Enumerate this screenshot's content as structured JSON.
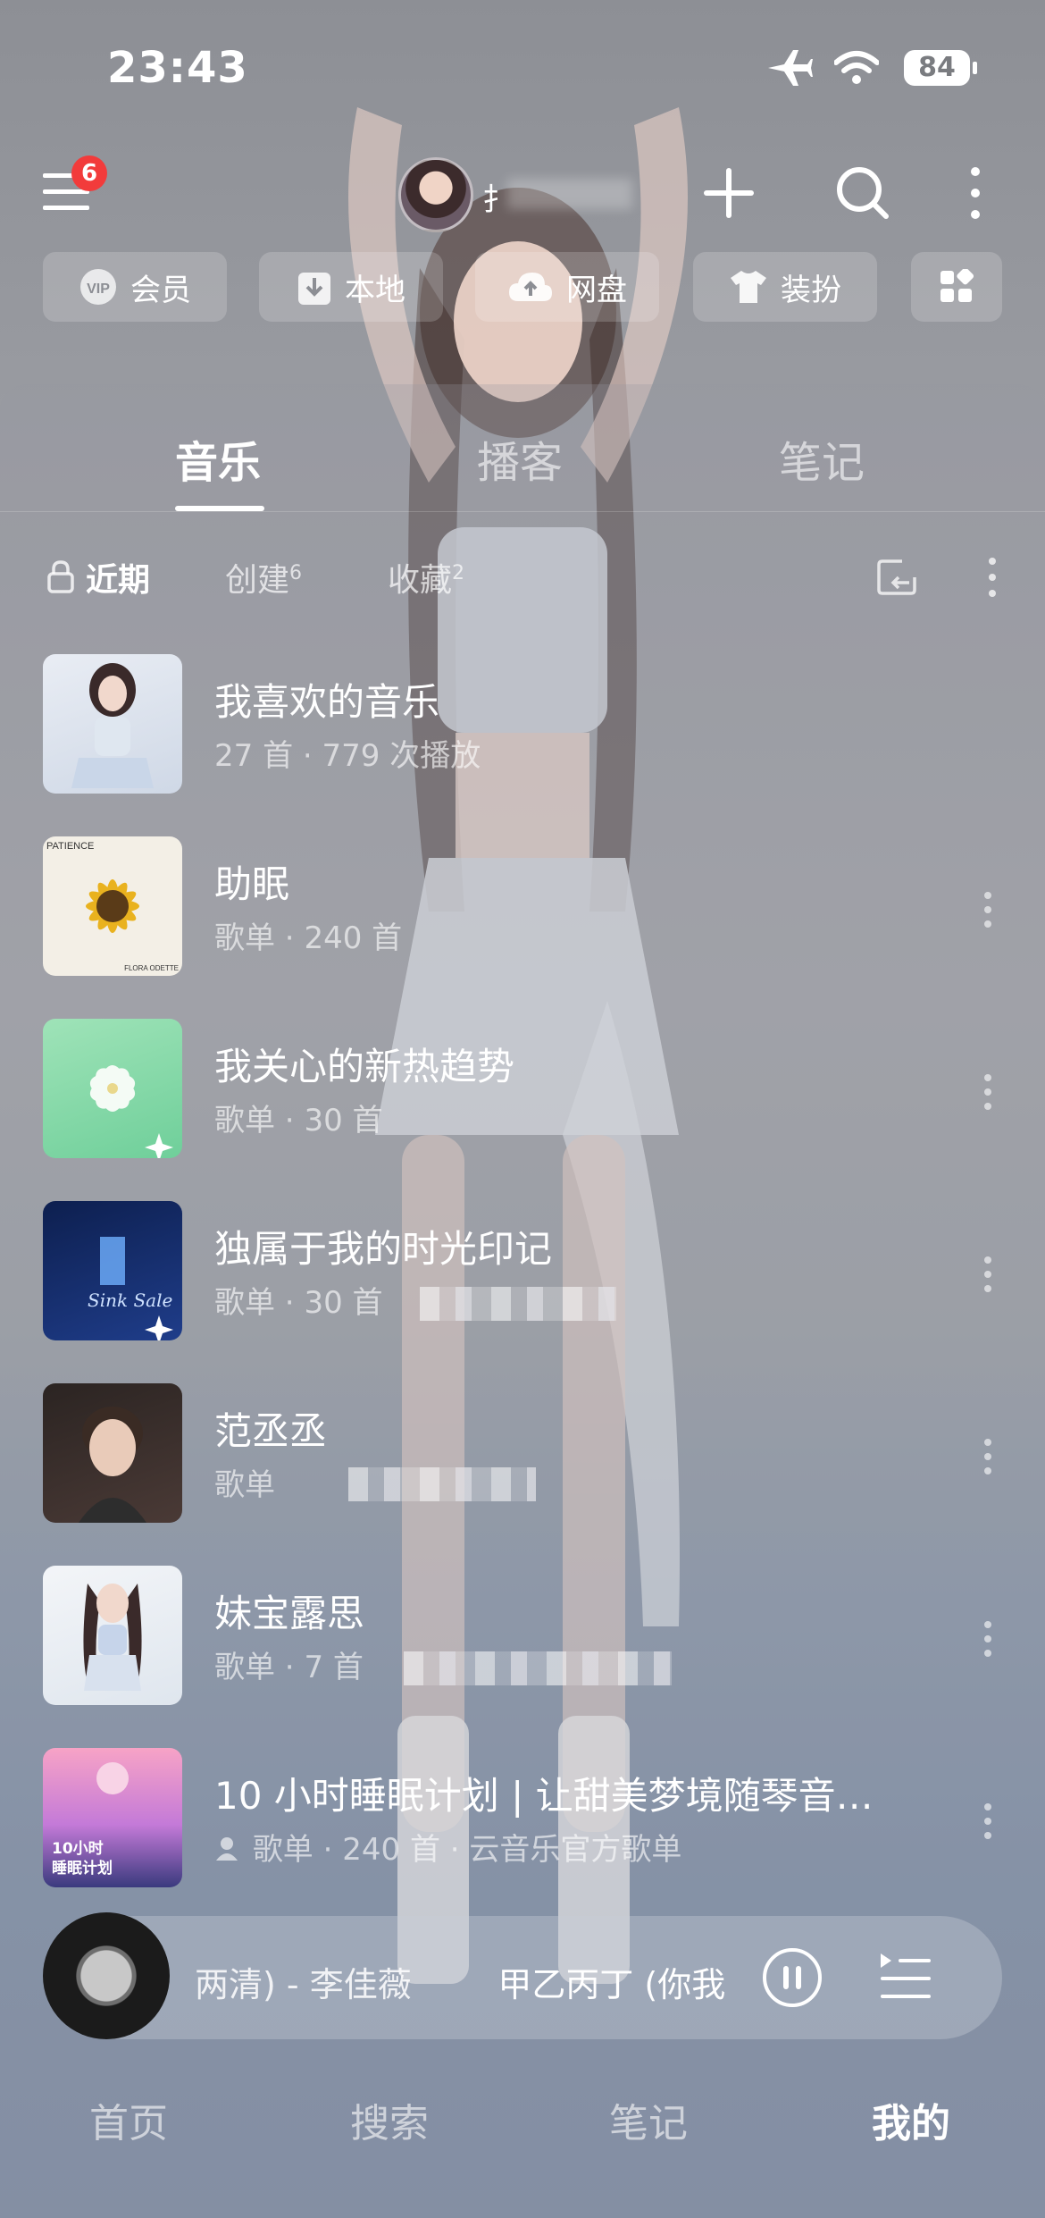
{
  "status": {
    "time": "23:43",
    "battery": "84"
  },
  "topbar": {
    "badge": "6",
    "username": "扌"
  },
  "shortcuts": [
    {
      "label": "会员",
      "icon": "vip-icon"
    },
    {
      "label": "本地",
      "icon": "download-icon"
    },
    {
      "label": "网盘",
      "icon": "cloud-icon"
    },
    {
      "label": "装扮",
      "icon": "shirt-icon"
    }
  ],
  "tabs": [
    {
      "label": "音乐"
    },
    {
      "label": "播客"
    },
    {
      "label": "笔记"
    }
  ],
  "filters": [
    {
      "label": "近期"
    },
    {
      "label": "创建",
      "count": "6"
    },
    {
      "label": "收藏",
      "count": "2"
    }
  ],
  "playlists": [
    {
      "title": "我喜欢的音乐",
      "kind": "27 首",
      "extra": "779 次播放"
    },
    {
      "title": "助眠",
      "kind": "歌单",
      "extra": "240 首",
      "cover_text_top": "PATIENCE",
      "cover_text_bottom": "FLORA ODETTE"
    },
    {
      "title": "我关心的新热趋势",
      "kind": "歌单",
      "extra": "30 首"
    },
    {
      "title": "独属于我的时光印记",
      "kind": "歌单",
      "extra": "30 首"
    },
    {
      "title": "范丞丞",
      "kind": "歌单",
      "extra": ""
    },
    {
      "title": "妹宝露思",
      "kind": "歌单",
      "extra": "7 首"
    },
    {
      "title": "10 小时睡眠计划 | 让甜美梦境随琴音…",
      "kind": "歌单",
      "extra": "240 首",
      "extra2": "云音乐官方歌单",
      "cover_text": "10小时\n睡眠计划"
    }
  ],
  "player": {
    "song_prefix": "两清) - 李佳薇",
    "song_next": "甲乙丙丁 (你我"
  },
  "nav": [
    {
      "label": "首页"
    },
    {
      "label": "搜索"
    },
    {
      "label": "笔记"
    },
    {
      "label": "我的"
    }
  ],
  "colors": {
    "accent_red": "#f23b3b"
  }
}
